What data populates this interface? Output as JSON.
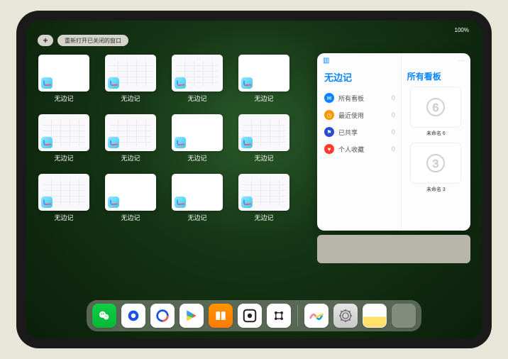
{
  "status": {
    "time": "",
    "battery": "100%"
  },
  "topbar": {
    "plus_label": "+",
    "reopen_label": "重新打开已关闭的窗口"
  },
  "app_switcher": {
    "items": [
      {
        "label": "无边记",
        "style": "blank"
      },
      {
        "label": "无边记",
        "style": "populated"
      },
      {
        "label": "无边记",
        "style": "populated"
      },
      {
        "label": "无边记",
        "style": "blank"
      },
      {
        "label": "无边记",
        "style": "populated"
      },
      {
        "label": "无边记",
        "style": "populated"
      },
      {
        "label": "无边记",
        "style": "blank"
      },
      {
        "label": "无边记",
        "style": "populated"
      },
      {
        "label": "无边记",
        "style": "populated"
      },
      {
        "label": "无边记",
        "style": "blank"
      },
      {
        "label": "无边记",
        "style": "blank"
      },
      {
        "label": "无边记",
        "style": "populated"
      }
    ]
  },
  "side_panel": {
    "left_title": "无边记",
    "right_title": "所有看板",
    "menu": [
      {
        "icon": "message",
        "color": "mi-blue",
        "label": "所有看板",
        "count": "0"
      },
      {
        "icon": "clock",
        "color": "mi-orange",
        "label": "最近使用",
        "count": "0"
      },
      {
        "icon": "people",
        "color": "mi-darkblue",
        "label": "已共享",
        "count": "0"
      },
      {
        "icon": "heart",
        "color": "mi-red",
        "label": "个人收藏",
        "count": "0"
      }
    ],
    "boards": [
      {
        "label": "未命名 6",
        "sub": "",
        "drawing": "6"
      },
      {
        "label": "未命名 3",
        "sub": "",
        "drawing": "3"
      }
    ],
    "ellipsis": "···"
  },
  "dock": {
    "apps": [
      {
        "name": "wechat-icon"
      },
      {
        "name": "qq-icon"
      },
      {
        "name": "quark-icon"
      },
      {
        "name": "play-icon"
      },
      {
        "name": "books-icon"
      },
      {
        "name": "obs-icon"
      },
      {
        "name": "tools-icon"
      },
      {
        "name": "freeform-icon"
      },
      {
        "name": "settings-icon"
      },
      {
        "name": "notes-icon"
      },
      {
        "name": "app-folder-icon"
      }
    ]
  }
}
